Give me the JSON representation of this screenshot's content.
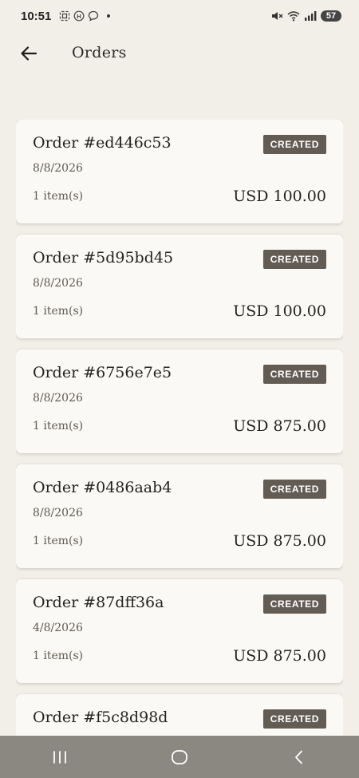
{
  "status_bar": {
    "time": "10:51",
    "battery": "57",
    "icons": [
      "screen-record-icon",
      "h-badge-icon",
      "chat-icon",
      "mute-icon",
      "wifi-icon",
      "signal-icon",
      "battery-icon"
    ]
  },
  "header": {
    "title": "Orders",
    "back_icon": "arrow-left-icon"
  },
  "orders": [
    {
      "title": "Order #ed446c53",
      "date": "8/8/2026",
      "status": "CREATED",
      "items": "1 item(s)",
      "total": "USD 100.00"
    },
    {
      "title": "Order #5d95bd45",
      "date": "8/8/2026",
      "status": "CREATED",
      "items": "1 item(s)",
      "total": "USD 100.00"
    },
    {
      "title": "Order #6756e7e5",
      "date": "8/8/2026",
      "status": "CREATED",
      "items": "1 item(s)",
      "total": "USD 875.00"
    },
    {
      "title": "Order #0486aab4",
      "date": "8/8/2026",
      "status": "CREATED",
      "items": "1 item(s)",
      "total": "USD 875.00"
    },
    {
      "title": "Order #87dff36a",
      "date": "4/8/2026",
      "status": "CREATED",
      "items": "1 item(s)",
      "total": "USD 875.00"
    },
    {
      "title": "Order #f5c8d98d",
      "date": "",
      "status": "CREATED",
      "items": "",
      "total": ""
    }
  ],
  "colors": {
    "background": "#f2efe8",
    "card": "#fbf9f5",
    "badge": "#625c55",
    "nav_bar": "#8b8781"
  },
  "nav": {
    "icons": [
      "recent-apps-icon",
      "home-icon",
      "back-icon"
    ]
  }
}
